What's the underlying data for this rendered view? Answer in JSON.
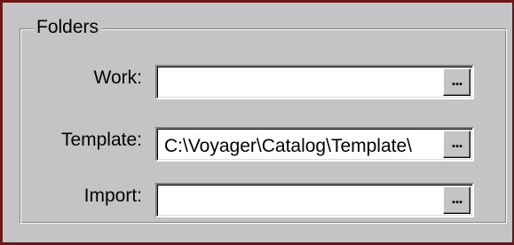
{
  "folders_group": {
    "title": "Folders",
    "rows": [
      {
        "label": "Work:",
        "value": "",
        "browse_label": "..."
      },
      {
        "label": "Template:",
        "value": "C:\\Voyager\\Catalog\\Template\\",
        "browse_label": "..."
      },
      {
        "label": "Import:",
        "value": "",
        "browse_label": "..."
      }
    ]
  }
}
